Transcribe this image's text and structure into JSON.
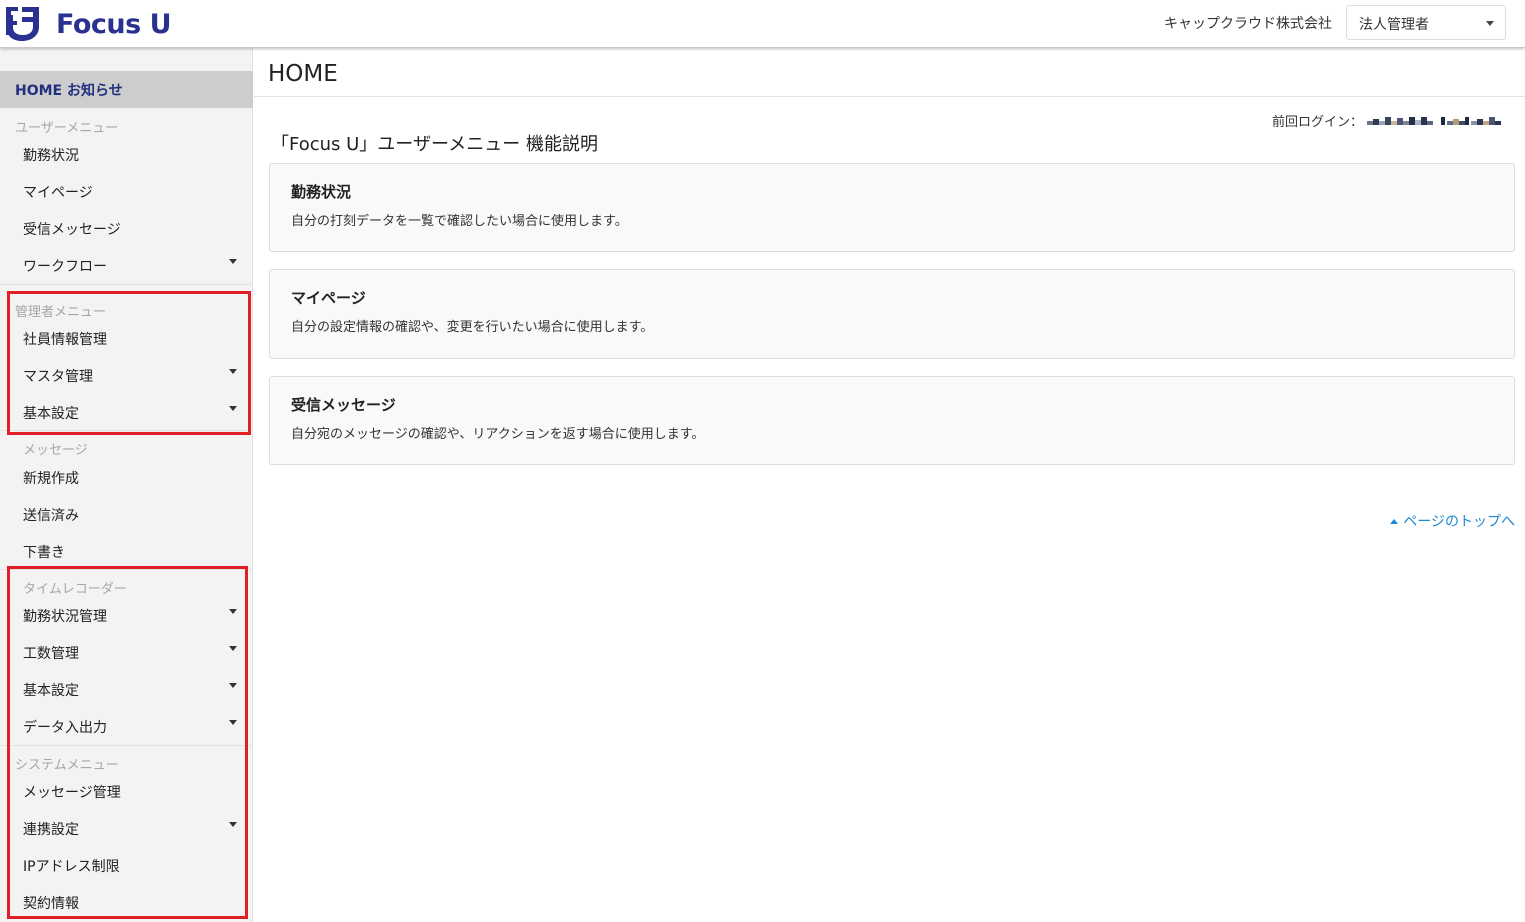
{
  "brand": {
    "name": "Focus U",
    "color": "#2a3190"
  },
  "header": {
    "company": "キャップクラウド株式会社",
    "role_select": {
      "selected": "法人管理者",
      "icon": "caret-down-icon"
    }
  },
  "sidebar": {
    "home": "HOME お知らせ",
    "user_menu": {
      "heading": "ユーザーメニュー",
      "items": [
        "勤務状況",
        "マイページ",
        "受信メッセージ",
        "ワークフロー"
      ]
    },
    "admin_menu": {
      "heading": "管理者メニュー",
      "items": [
        "社員情報管理",
        "マスタ管理",
        "基本設定"
      ]
    },
    "message_menu": {
      "heading": "メッセージ",
      "items": [
        "新規作成",
        "送信済み",
        "下書き"
      ]
    },
    "time_recorder_menu": {
      "heading": "タイムレコーダー",
      "items": [
        "勤務状況管理",
        "工数管理",
        "基本設定",
        "データ入出力"
      ]
    },
    "system_menu": {
      "heading": "システムメニュー",
      "items": [
        "メッセージ管理",
        "連携設定",
        "IPアドレス制限",
        "契約情報"
      ]
    },
    "highlight_color": "#e01f27"
  },
  "main": {
    "page_title": "HOME",
    "last_login_label": "前回ログイン：",
    "section_title": "「Focus U」ユーザーメニュー 機能説明",
    "cards": [
      {
        "title": "勤務状況",
        "desc": "自分の打刻データを一覧で確認したい場合に使用します。"
      },
      {
        "title": "マイページ",
        "desc": "自分の設定情報の確認や、変更を行いたい場合に使用します。"
      },
      {
        "title": "受信メッセージ",
        "desc": "自分宛のメッセージの確認や、リアクションを返す場合に使用します。"
      }
    ],
    "to_top": "ページのトップへ",
    "link_color": "#1f86d1"
  }
}
